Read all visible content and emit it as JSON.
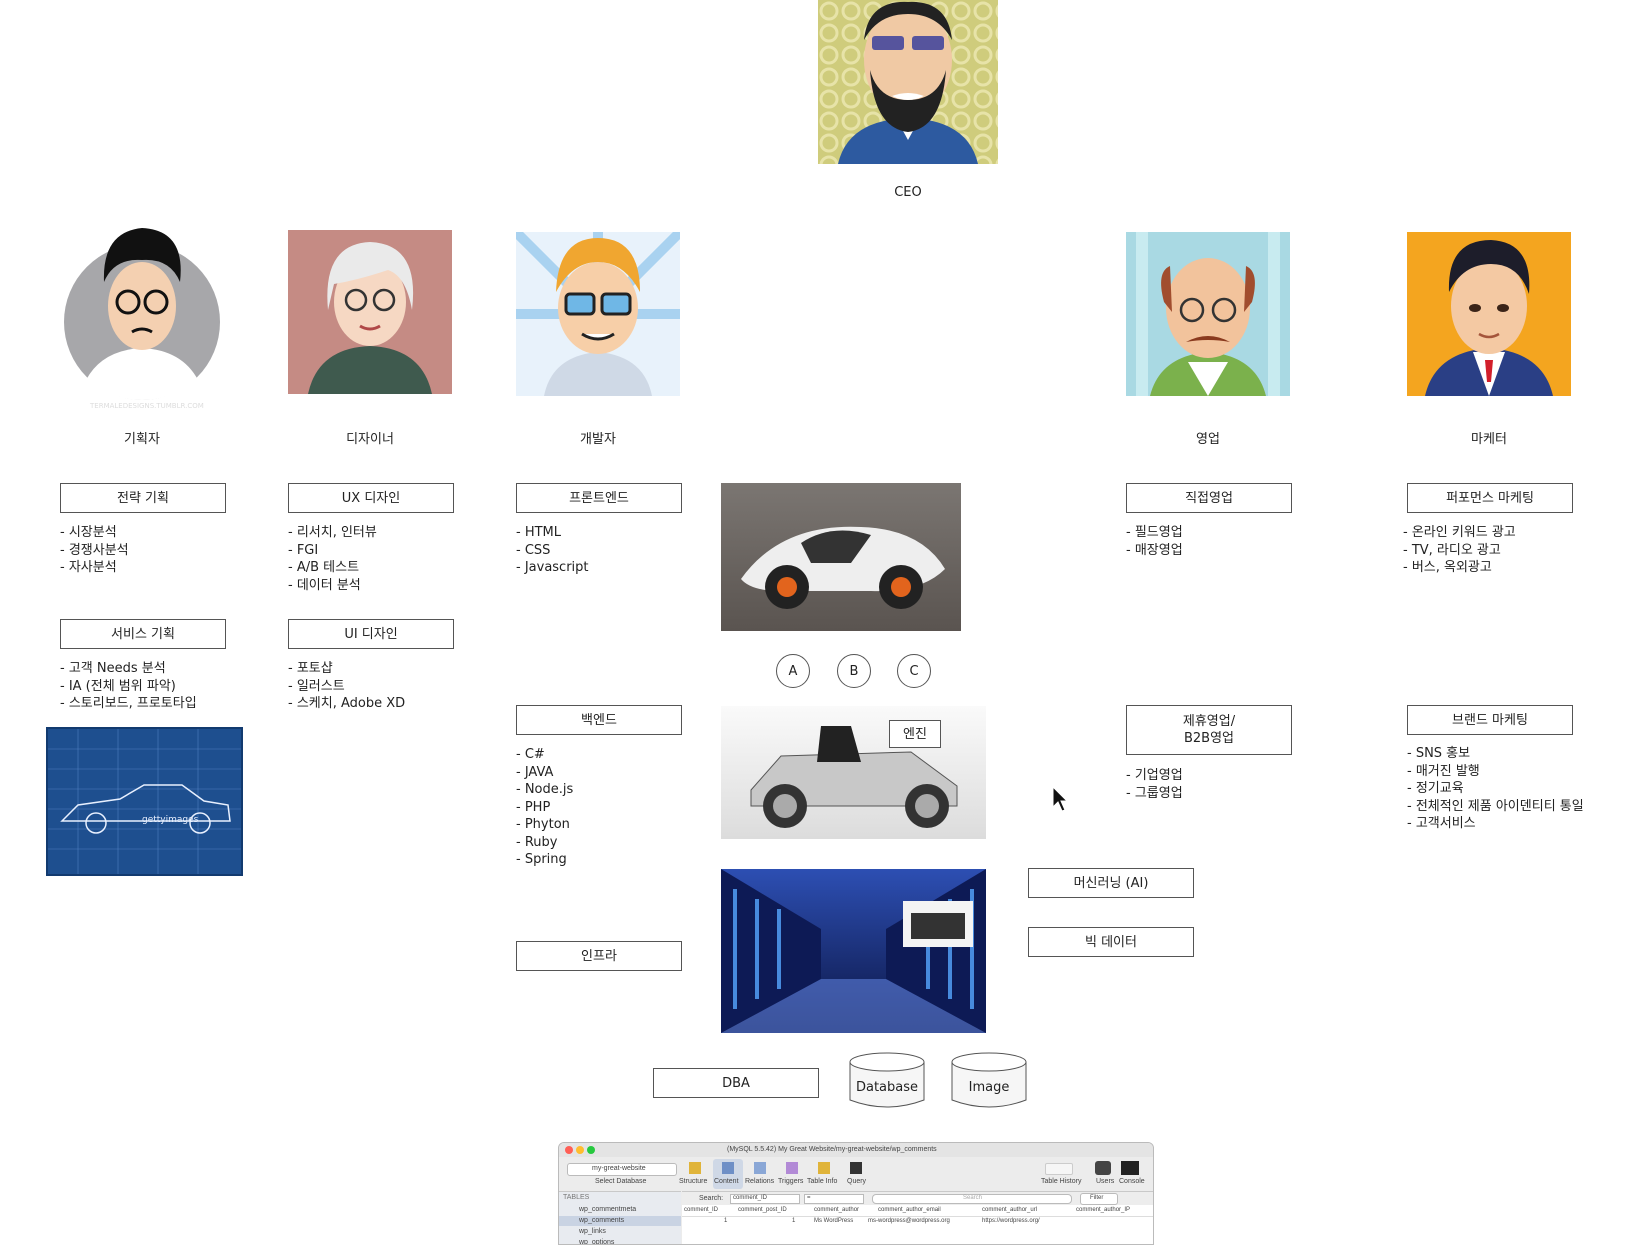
{
  "ceo": {
    "label": "CEO"
  },
  "roles": {
    "planner": {
      "label": "기획자"
    },
    "designer": {
      "label": "디자이너"
    },
    "developer": {
      "label": "개발자"
    },
    "sales": {
      "label": "영업"
    },
    "marketer": {
      "label": "마케터"
    }
  },
  "planner": {
    "box1": "전략 기획",
    "list1": [
      "- 시장분석",
      "- 경쟁사분석",
      "- 자사분석"
    ],
    "box2": "서비스 기획",
    "list2": [
      "- 고객 Needs 분석",
      "- IA (전체 범위 파악)",
      "- 스토리보드, 프로토타입"
    ]
  },
  "designer": {
    "box1": "UX 디자인",
    "list1": [
      "- 리서치, 인터뷰",
      "- FGI",
      "- A/B 테스트",
      "- 데이터 분석"
    ],
    "box2": "UI 디자인",
    "list2": [
      "- 포토샵",
      "- 일러스트",
      "- 스케치, Adobe XD"
    ]
  },
  "developer": {
    "box1": "프론트엔드",
    "list1": [
      "- HTML",
      "- CSS",
      "- Javascript"
    ],
    "box2": "백엔드",
    "list2": [
      "- C#",
      "- JAVA",
      "- Node.js",
      "- PHP",
      "- Phyton",
      "- Ruby",
      "- Spring"
    ],
    "box3": "인프라"
  },
  "center": {
    "circles": [
      "A",
      "B",
      "C"
    ],
    "engine_label": "엔진",
    "dba": "DBA",
    "database": "Database",
    "image": "Image",
    "ml": "머신러닝 (AI)",
    "bigdata": "빅 데이터"
  },
  "sales": {
    "box1": "직접영업",
    "list1": [
      "- 필드영업",
      "- 매장영업"
    ],
    "box2": "제휴영업/\nB2B영업",
    "list2": [
      "- 기업영업",
      "- 그룹영업"
    ]
  },
  "marketer": {
    "box1": "퍼포먼스 마케팅",
    "list1": [
      "- 온라인 키워드 광고",
      "- TV, 라디오 광고",
      "- 버스, 옥외광고"
    ],
    "box2": "브랜드 마케팅",
    "list2": [
      "- SNS 홍보",
      "- 매거진 발행",
      "- 정기교육",
      "- 전체적인 제품 아이덴티티 통일",
      "- 고객서비스"
    ]
  },
  "watermarks": {
    "avatar": "TERMALEDESIGNS.TUMBLR.COM",
    "getty": "gettyimages"
  },
  "sequel": {
    "title": "(MySQL 5.5.42) My Great Website/my-great-website/wp_comments",
    "db_select": "my-great-website",
    "select_db": "Select Database",
    "toolbar": [
      "Structure",
      "Content",
      "Relations",
      "Triggers",
      "Table Info",
      "Query"
    ],
    "right_toolbar": [
      "Table History",
      "Users",
      "Console"
    ],
    "tables_header": "TABLES",
    "tables": [
      "wp_commentmeta",
      "wp_comments",
      "wp_links",
      "wp_options"
    ],
    "search_label": "Search:",
    "search_field": "comment_ID",
    "search_op": "=",
    "search_placeholder": "Search",
    "filter": "Filter",
    "columns": [
      "comment_ID",
      "comment_post_ID",
      "comment_author",
      "comment_author_email",
      "comment_author_url",
      "comment_author_IP"
    ],
    "row": [
      "1",
      "1",
      "Ms WordPress",
      "ms-wordpress@wordpress.org",
      "https://wordpress.org/",
      ""
    ]
  },
  "colors": {
    "accent": "#1e4f8f",
    "border": "#555555"
  }
}
